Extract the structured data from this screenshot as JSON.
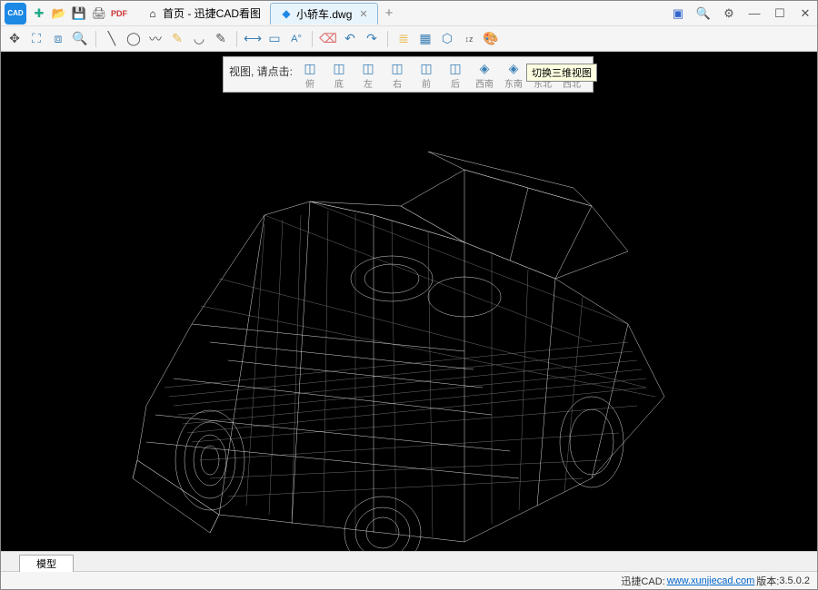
{
  "app": {
    "logo_text": "CAD"
  },
  "title_icons": [
    "new",
    "open",
    "save",
    "print",
    "pdf"
  ],
  "tabs": {
    "home": {
      "label": "首页 - 迅捷CAD看图"
    },
    "active": {
      "label": "小轿车.dwg"
    }
  },
  "toolbar": {
    "groups": [
      [
        "pan",
        "extent",
        "window",
        "measure"
      ],
      [
        "line",
        "circle",
        "polyline",
        "pen",
        "arc",
        "text"
      ],
      [
        "dim",
        "align",
        "leader"
      ],
      [
        "erase",
        "undo",
        "redo"
      ],
      [
        "layer",
        "block",
        "view3d",
        "elev",
        "color"
      ]
    ]
  },
  "viewpanel": {
    "label": "视图, 请点击:",
    "buttons": [
      {
        "label": "俯"
      },
      {
        "label": "底"
      },
      {
        "label": "左"
      },
      {
        "label": "右"
      },
      {
        "label": "前"
      },
      {
        "label": "后"
      },
      {
        "label": "西南"
      },
      {
        "label": "东南"
      },
      {
        "label": "东北"
      },
      {
        "label": "西北"
      }
    ]
  },
  "tooltip": "切换三维视图",
  "bottom_tab": "模型",
  "status": {
    "prefix": "迅捷CAD: ",
    "url": "www.xunjiecad.com",
    "version_label": " 版本: ",
    "version": "3.5.0.2"
  }
}
